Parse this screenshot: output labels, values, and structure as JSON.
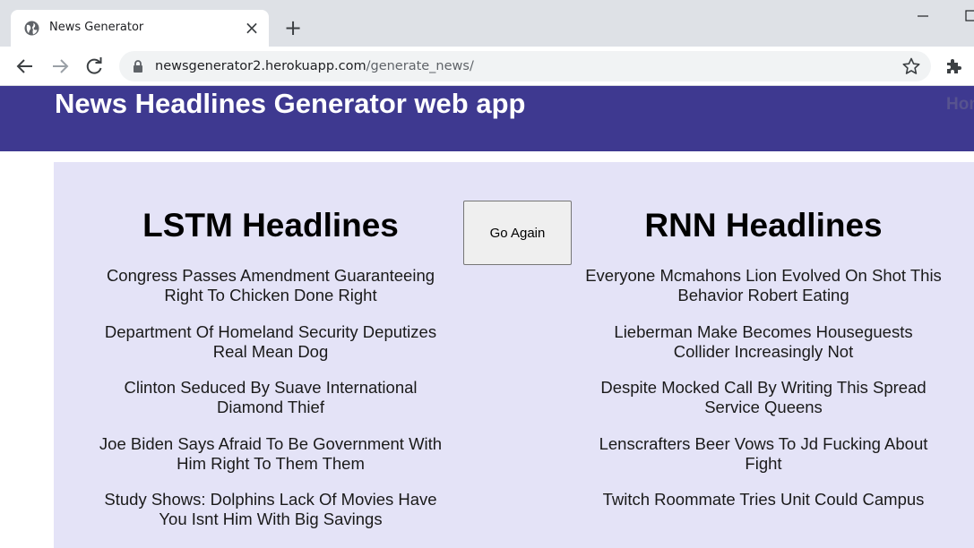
{
  "browser": {
    "tab_title": "News Generator",
    "tab_close": "×",
    "new_tab": "+",
    "url_host": "newsgenerator2.herokuapp.com",
    "url_path": "/generate_news/",
    "icons": {
      "favicon": "globe-icon",
      "back": "arrow-left-icon",
      "forward": "arrow-right-icon",
      "reload": "reload-icon",
      "lock": "lock-icon",
      "bookmark": "star-icon",
      "extensions": "puzzle-icon"
    }
  },
  "site": {
    "title": "News Headlines Generator web app",
    "nav_home": "Home",
    "header_color": "#3e3990",
    "panel_color": "#e4e3f7"
  },
  "lstm": {
    "heading": "LSTM Headlines",
    "headlines": [
      "Congress Passes Amendment Guaranteeing Right To Chicken Done Right",
      "Department Of Homeland Security Deputizes Real Mean Dog",
      "Clinton Seduced By Suave International Diamond Thief",
      "Joe Biden Says Afraid To Be Government With Him Right To Them Them",
      "Study Shows: Dolphins Lack Of Movies Have You Isnt Him With Big Savings"
    ]
  },
  "rnn": {
    "heading": "RNN Headlines",
    "headlines": [
      "Everyone Mcmahons Lion Evolved On Shot This Behavior Robert Eating",
      "Lieberman Make Becomes Houseguests Collider Increasingly Not",
      "Despite Mocked Call By Writing This Spread Service Queens",
      "Lenscrafters Beer Vows To Jd Fucking About Fight",
      "Twitch Roommate Tries Unit Could Campus"
    ]
  },
  "actions": {
    "go_again_label": "Go Again"
  }
}
